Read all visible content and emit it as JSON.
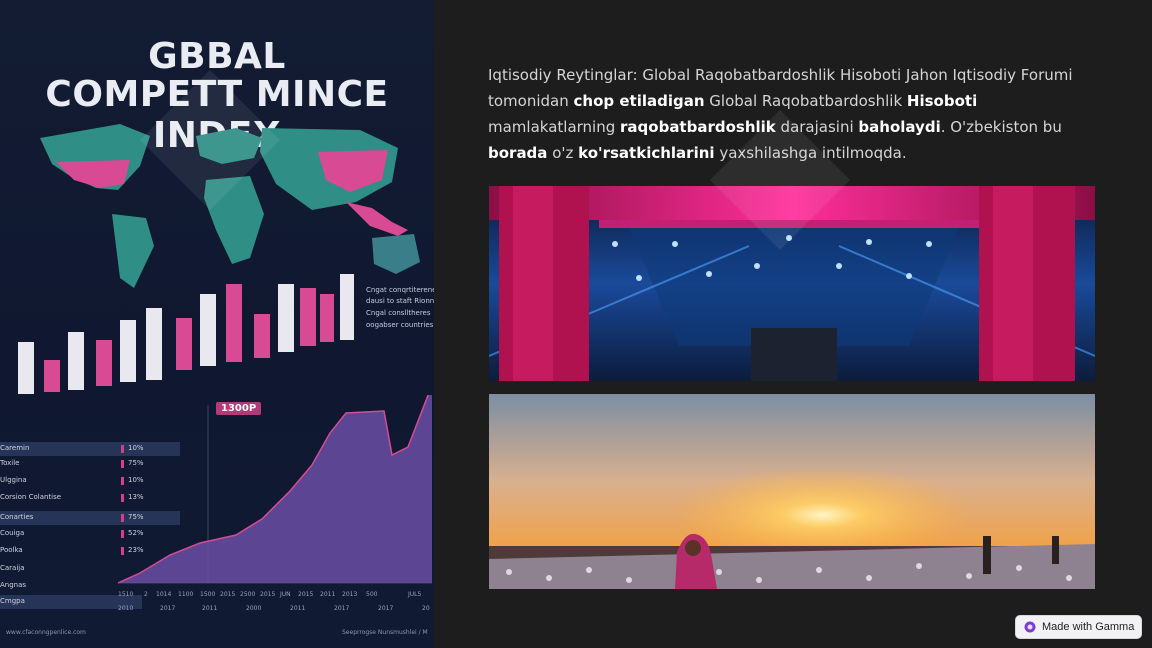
{
  "infographic": {
    "title_line1": "GBBAL",
    "title_line2": "COMPETT MINCE INDEX",
    "side_notes": [
      "Cngat conqrtiterene",
      "dausi to staft Rionn",
      "Cngal conslltheres",
      "oogabser countries"
    ],
    "highlight_tag": "1300P",
    "rows": [
      {
        "label": "Caremin",
        "pct": "10%"
      },
      {
        "label": "Toxile",
        "pct": "75%"
      },
      {
        "label": "Ulggina",
        "pct": "10%"
      },
      {
        "label": "Corsion Colantise",
        "pct": "13%"
      },
      {
        "label": "Conarties",
        "pct": "75%"
      },
      {
        "label": "Couiga",
        "pct": "52%"
      },
      {
        "label": "Poolka",
        "pct": "23%"
      },
      {
        "label": "Caraija",
        "pct": ""
      },
      {
        "label": "Angnas",
        "pct": ""
      },
      {
        "label": "Cmgpa",
        "pct": ""
      }
    ],
    "x_years_row1": [
      "1510",
      "2",
      "1014",
      "1100",
      "1500",
      "2015",
      "2500",
      "2015",
      "JUN",
      "2015",
      "2011",
      "2013",
      "500",
      "JUL5"
    ],
    "x_years_row2": [
      "2010",
      "2017",
      "2011",
      "2000",
      "2011",
      "2017",
      "2017",
      "20"
    ],
    "footer_left": "www.cfaconngpenlice.com",
    "footer_right": "Seeprrogse Nunsmushlei / M"
  },
  "paragraph": {
    "p1": "Iqtisodiy Reytinglar: Global Raqobatbardoshlik Hisoboti Jahon Iqtisodiy Forumi tomonidan ",
    "b1": "chop etiladigan",
    "p2": " Global Raqobatbardoshlik ",
    "b2": "Hisoboti",
    "p3": " mamlakatlarning ",
    "b3": "raqobatbardoshlik",
    "p4": " darajasini ",
    "b4": "baholaydi",
    "p5": ". O'zbekiston bu ",
    "b5": "borada",
    "p6": " o'z ",
    "b6": "ko'rsatkichlarini",
    "p7": " yaxshilashga intilmoqda."
  },
  "images": {
    "factory_alt": "factory interior",
    "cotton_field_alt": "cotton field at sunset"
  },
  "badge": {
    "label": "Made with Gamma"
  },
  "colors": {
    "background": "#1d1d1d",
    "accent_pink": "#d63d8b",
    "accent_teal": "#2f8f86"
  }
}
